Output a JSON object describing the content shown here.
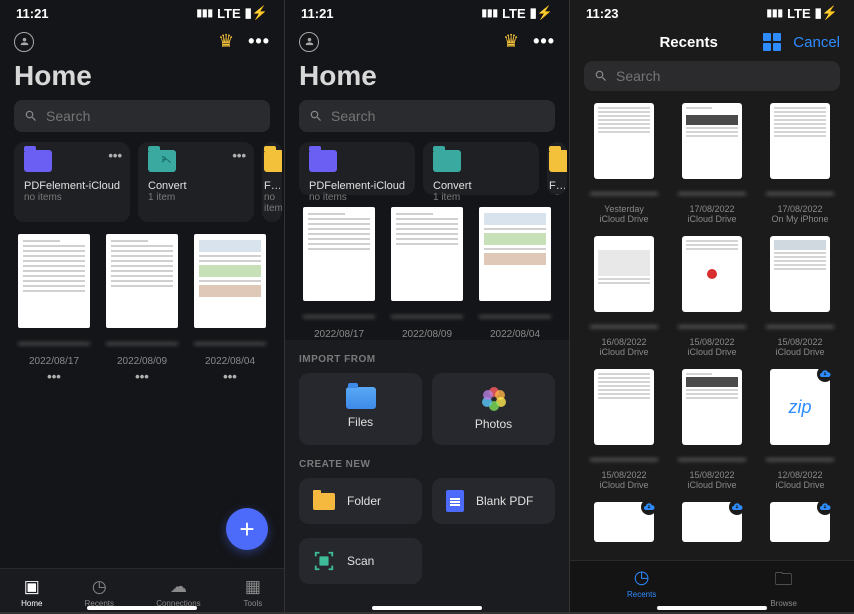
{
  "screen1": {
    "status": {
      "time": "11:21",
      "network": "LTE"
    },
    "title": "Home",
    "search_placeholder": "Search",
    "folders": [
      {
        "name": "PDFelement-iCloud",
        "sub": "no items",
        "color": "purple"
      },
      {
        "name": "Convert",
        "sub": "1 item",
        "color": "teal"
      },
      {
        "name": "Favori",
        "sub": "no item",
        "color": "yellow"
      }
    ],
    "files": [
      {
        "date": "2022/08/17"
      },
      {
        "date": "2022/08/09"
      },
      {
        "date": "2022/08/04"
      }
    ],
    "tabs": [
      {
        "label": "Home",
        "active": true
      },
      {
        "label": "Recents",
        "active": false
      },
      {
        "label": "Connections",
        "active": false
      },
      {
        "label": "Tools",
        "active": false
      }
    ]
  },
  "screen2": {
    "status": {
      "time": "11:21",
      "network": "LTE"
    },
    "title": "Home",
    "search_placeholder": "Search",
    "folders": [
      {
        "name": "PDFelement-iCloud",
        "sub": "no items",
        "color": "purple"
      },
      {
        "name": "Convert",
        "sub": "1 item",
        "color": "teal"
      },
      {
        "name": "Favori",
        "sub": "no item",
        "color": "yellow"
      }
    ],
    "files": [
      {
        "date": "2022/08/17"
      },
      {
        "date": "2022/08/09"
      },
      {
        "date": "2022/08/04"
      }
    ],
    "import_label": "IMPORT FROM",
    "import": [
      {
        "label": "Files"
      },
      {
        "label": "Photos"
      }
    ],
    "create_label": "CREATE NEW",
    "create": [
      {
        "label": "Folder"
      },
      {
        "label": "Blank PDF"
      },
      {
        "label": "Scan"
      }
    ]
  },
  "screen3": {
    "status": {
      "time": "11:23",
      "network": "LTE"
    },
    "header_title": "Recents",
    "cancel": "Cancel",
    "search_placeholder": "Search",
    "items": [
      {
        "date": "Yesterday",
        "loc": "iCloud Drive"
      },
      {
        "date": "17/08/2022",
        "loc": "iCloud Drive"
      },
      {
        "date": "17/08/2022",
        "loc": "On My iPhone"
      },
      {
        "date": "16/08/2022",
        "loc": "iCloud Drive"
      },
      {
        "date": "15/08/2022",
        "loc": "iCloud Drive"
      },
      {
        "date": "15/08/2022",
        "loc": "iCloud Drive"
      },
      {
        "date": "15/08/2022",
        "loc": "iCloud Drive"
      },
      {
        "date": "15/08/2022",
        "loc": "iCloud Drive"
      },
      {
        "date": "12/08/2022",
        "loc": "iCloud Drive",
        "zip": true
      }
    ],
    "tabs": [
      {
        "label": "Recents",
        "active": true
      },
      {
        "label": "Browse",
        "active": false
      }
    ]
  }
}
